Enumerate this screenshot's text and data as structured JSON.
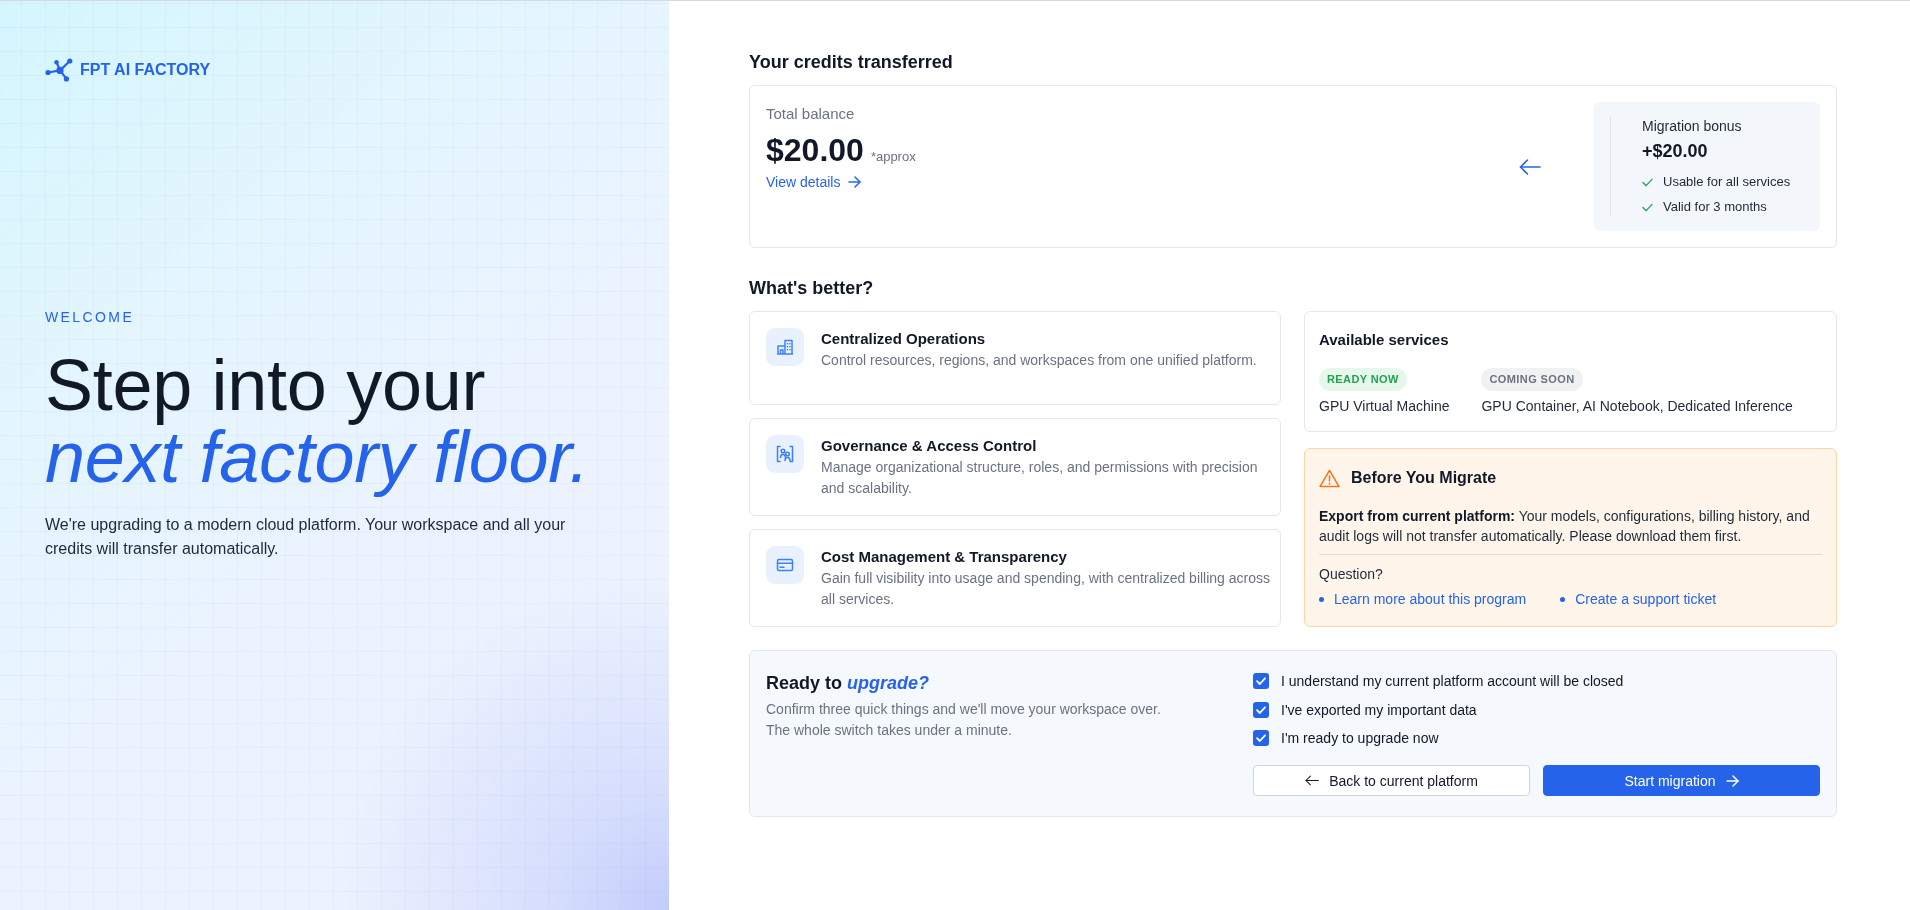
{
  "brand": {
    "name": "FPT AI FACTORY"
  },
  "hero": {
    "eyebrow": "WELCOME",
    "headline": "Step into your *next factory floor.*",
    "description": "We're upgrading to a modern cloud platform. Your workspace and all your credits will transfer automatically."
  },
  "credits": {
    "heading": "Your credits transferred",
    "balance_label": "Total balance",
    "balance": "$20.00",
    "balance_note": "*approx",
    "details_link": "View details",
    "bonus": {
      "label": "Migration bonus",
      "amount": "+$20.00",
      "perks": [
        "Usable for all services",
        "Valid for 3 months"
      ]
    }
  },
  "benefits": {
    "heading": "What's better?",
    "items": [
      {
        "kind": "building",
        "title": "Centralized Operations",
        "description": "Control resources, regions, and workspaces from one unified platform."
      },
      {
        "kind": "people",
        "title": "Governance & Access Control",
        "description": "Manage organizational structure, roles, and permissions with precision and scalability."
      },
      {
        "kind": "card",
        "title": "Cost Management & Transparency",
        "description": "Gain full visibility into usage and spending, with centralized billing across all services."
      }
    ]
  },
  "services": {
    "heading": "Available services",
    "groups": [
      {
        "kind": "ready",
        "status": "READY NOW",
        "services": "GPU Virtual Machine"
      },
      {
        "kind": "soon",
        "status": "COMING SOON",
        "services": "GPU Container, AI Notebook, Dedicated Inference"
      }
    ]
  },
  "notice": {
    "title": "Before You Migrate",
    "body": "**Export from current platform:** Your models, configurations, billing history, and audit logs will not transfer automatically. Please download them first.",
    "question": "Question?",
    "links": [
      "Learn more about this program",
      "Create a support ticket"
    ]
  },
  "confirm": {
    "title": "Ready to *upgrade?*",
    "description": "Confirm three quick things and we'll move your workspace over. The whole switch takes under a minute.",
    "checks": [
      {
        "label": "I understand my current platform account will be closed",
        "checked": true
      },
      {
        "label": "I've exported my important data",
        "checked": true
      },
      {
        "label": "I'm ready to upgrade now",
        "checked": true
      }
    ],
    "buttons": [
      {
        "kind": "secondary",
        "label": "Back to current platform"
      },
      {
        "kind": "primary",
        "label": "Start migration"
      }
    ]
  }
}
